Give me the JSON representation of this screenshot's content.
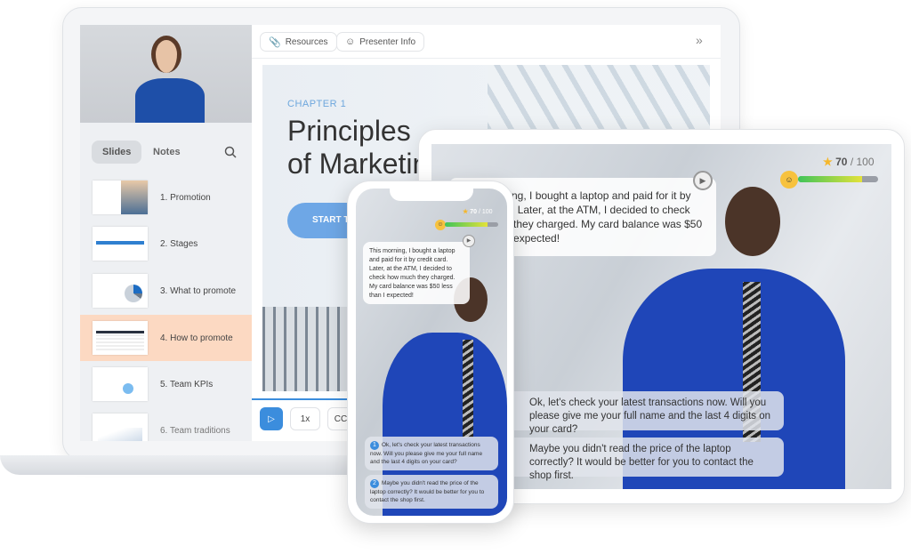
{
  "laptop": {
    "toolbar": {
      "resources": "Resources",
      "presenter_info": "Presenter Info",
      "collapse_icon": "double-chevron-right"
    },
    "sidebar": {
      "tabs": [
        "Slides",
        "Notes"
      ],
      "active_tab": "Slides",
      "search_icon": "search",
      "slides": [
        {
          "label": "1. Promotion"
        },
        {
          "label": "2. Stages"
        },
        {
          "label": "3. What to promote"
        },
        {
          "label": "4. How to promote",
          "active": true
        },
        {
          "label": "5. Team KPIs"
        },
        {
          "label": "6. Team traditions"
        }
      ]
    },
    "slide": {
      "chapter": "CHAPTER 1",
      "title_line1": "Principles",
      "title_line2": "of Marketing",
      "start_button": "START TRAINING"
    },
    "controls": {
      "play_icon": "play",
      "speed": "1x",
      "captions": "CC"
    },
    "accent": "#5b9de3",
    "active_slide_color": "#fcd9c2"
  },
  "scenario": {
    "score": "70",
    "score_max": "/ 100",
    "progress": 0.8,
    "message": "This morning, I bought a laptop and paid for it by credit card. Later, at the ATM, I decided to check how much they charged. My card balance was $50 less than I expected!",
    "options": [
      {
        "num": "1",
        "text": "Ok, let's check your latest transactions now. Will you please give me your full name and the last 4 digits on your card?"
      },
      {
        "num": "2",
        "text": "Maybe you didn't read the price of the laptop correctly? It would be better for you to contact the shop first."
      }
    ]
  }
}
